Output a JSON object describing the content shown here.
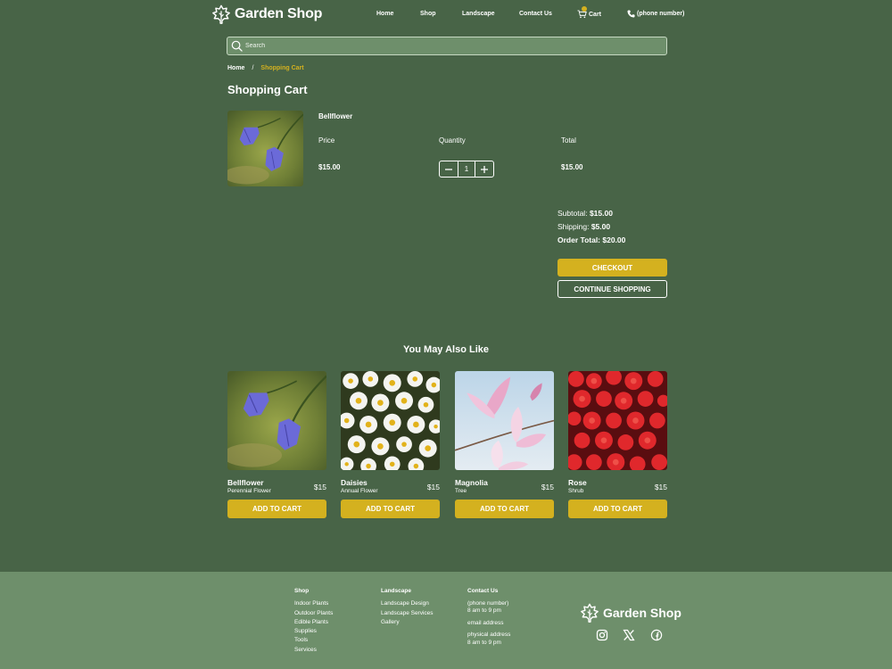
{
  "header": {
    "logo_text": "Garden Shop",
    "nav": [
      {
        "label": "Home"
      },
      {
        "label": "Shop"
      },
      {
        "label": "Landscape"
      },
      {
        "label": "Contact Us"
      }
    ],
    "cart_label": "Cart",
    "phone_label": "(phone number)"
  },
  "search": {
    "placeholder": "Search"
  },
  "breadcrumb": {
    "home": "Home",
    "separator": "/",
    "current": "Shopping Cart"
  },
  "page_title": "Shopping Cart",
  "cart_item": {
    "name": "Bellflower",
    "price_label": "Price",
    "quantity_label": "Quantity",
    "total_label": "Total",
    "price": "$15.00",
    "quantity": "1",
    "total": "$15.00"
  },
  "summary": {
    "subtotal_label": "Subtotal:",
    "subtotal": "$15.00",
    "shipping_label": "Shipping:",
    "shipping": "$5.00",
    "order_total_label": "Order Total:",
    "order_total": "$20.00",
    "checkout_label": "CHECKOUT",
    "continue_label": "CONTINUE SHOPPING"
  },
  "recommendations": {
    "title": "You May Also Like",
    "button_label": "ADD TO CART",
    "items": [
      {
        "name": "Bellflower",
        "type": "Perennial Flower",
        "price": "$15"
      },
      {
        "name": "Daisies",
        "type": "Annual Flower",
        "price": "$15"
      },
      {
        "name": "Magnolia",
        "type": "Tree",
        "price": "$15"
      },
      {
        "name": "Rose",
        "type": "Shrub",
        "price": "$15"
      }
    ]
  },
  "footer": {
    "shop": {
      "heading": "Shop",
      "links": [
        "Indoor Plants",
        "Outdoor Plants",
        "Edible Plants",
        "Supplies",
        "Tools",
        "Services"
      ]
    },
    "landscape": {
      "heading": "Landscape",
      "links": [
        "Landscape Design",
        "Landscape Services",
        "Gallery"
      ]
    },
    "contact": {
      "heading": "Contact Us",
      "phone": "(phone number)",
      "phone_hours": "8 am to 9 pm",
      "email": "email address",
      "address": "physical address",
      "address_hours": "8 am to 9 pm"
    },
    "logo_text": "Garden Shop",
    "social_icons": [
      "instagram-icon",
      "x-icon",
      "facebook-icon"
    ]
  },
  "colors": {
    "background": "#486447",
    "footer": "#6e8f6b",
    "accent": "#d4b11f"
  }
}
